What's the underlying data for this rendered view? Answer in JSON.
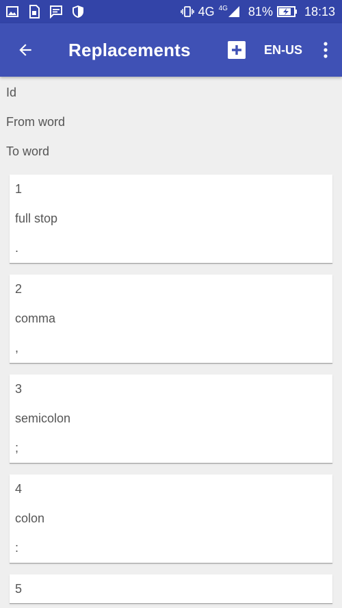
{
  "status": {
    "network": "4G",
    "network_small": "4G",
    "battery": "81%",
    "time": "18:13"
  },
  "toolbar": {
    "title": "Replacements",
    "language": "EN-US"
  },
  "labels": {
    "id": "Id",
    "from": "From word",
    "to": "To word"
  },
  "items": [
    {
      "id": "1",
      "from": "full stop",
      "to": "."
    },
    {
      "id": "2",
      "from": "comma",
      "to": ","
    },
    {
      "id": "3",
      "from": "semicolon",
      "to": ";"
    },
    {
      "id": "4",
      "from": "colon",
      "to": ":"
    },
    {
      "id": "5"
    }
  ],
  "colors": {
    "status_bar": "#3344a8",
    "app_bar": "#3f51b5",
    "background": "#efefef"
  }
}
